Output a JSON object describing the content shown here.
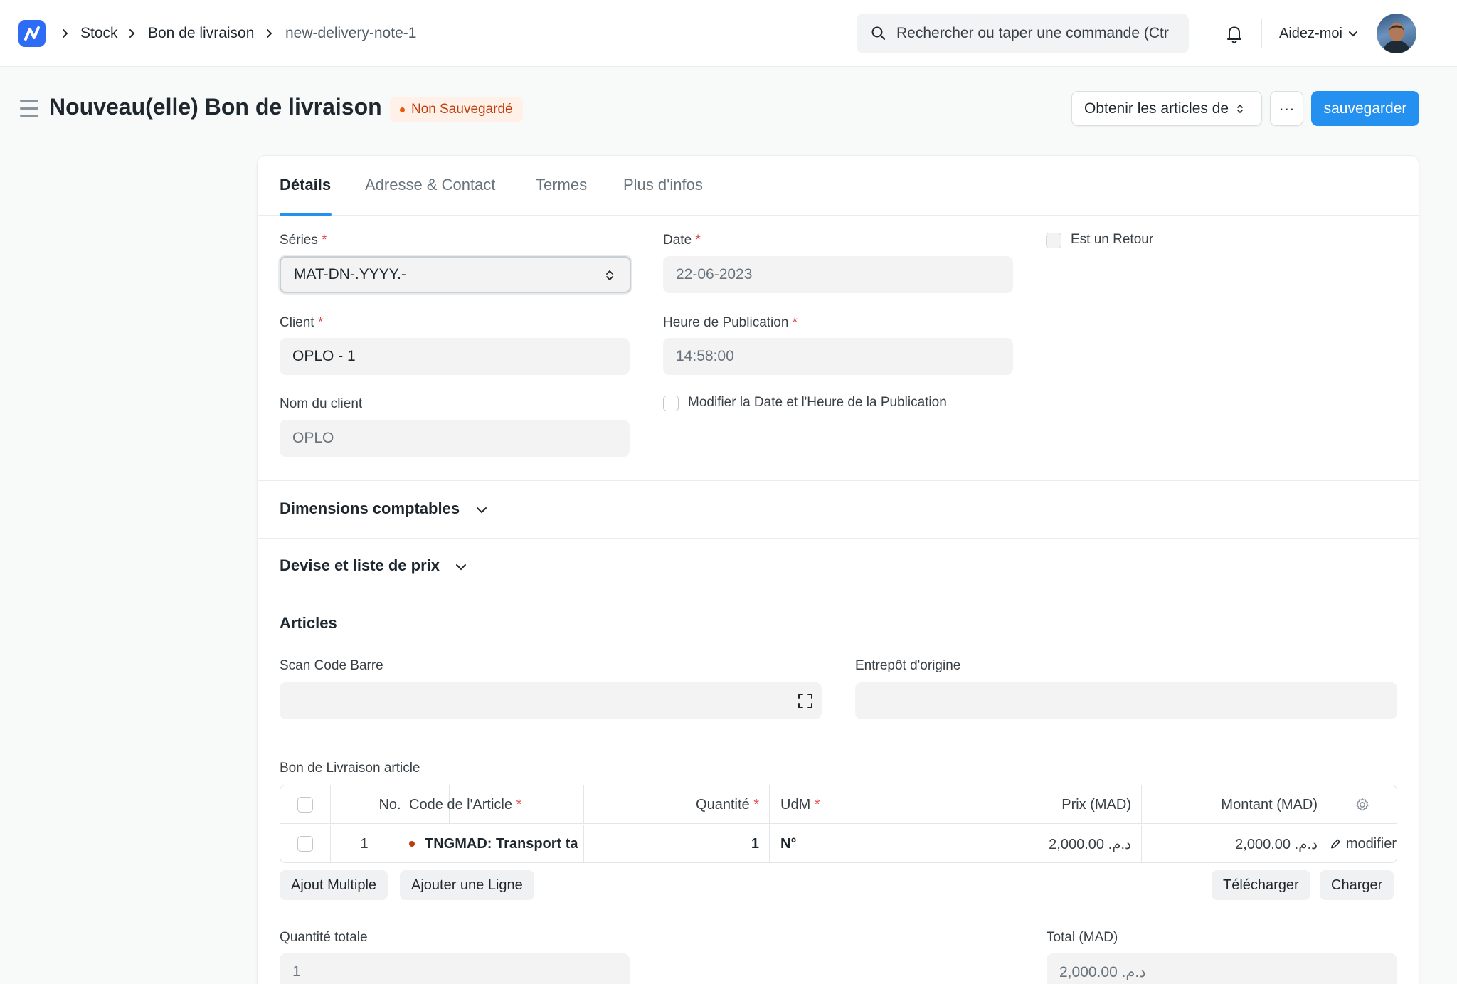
{
  "colors": {
    "primary": "#2490ef",
    "logo": "#2f6cf5",
    "unsaved_bg": "#fff1e7",
    "unsaved_text": "#bd3e0c"
  },
  "navbar": {
    "breadcrumbs": [
      "Stock",
      "Bon de livraison",
      "new-delivery-note-1"
    ],
    "search_placeholder": "Rechercher ou taper une commande (Ctr",
    "help_label": "Aidez-moi"
  },
  "header": {
    "title": "Nouveau(elle) Bon de livraison",
    "status": "Non Sauvegardé",
    "get_items_label": "Obtenir les articles de",
    "more_label": "···",
    "save_label": "sauvegarder"
  },
  "tabs": [
    "Détails",
    "Adresse & Contact",
    "Termes",
    "Plus d'infos"
  ],
  "details": {
    "series_label": "Séries",
    "series_value": "MAT-DN-.YYYY.-",
    "date_label": "Date",
    "date_value": "22-06-2023",
    "is_return_label": "Est un Retour",
    "client_label": "Client",
    "client_value": "OPLO - 1",
    "posting_time_label": "Heure de Publication",
    "posting_time_value": "14:58:00",
    "client_name_label": "Nom du client",
    "client_name_value": "OPLO",
    "edit_posting_label": "Modifier la Date et l'Heure de la Publication"
  },
  "sections": {
    "accounting_dimensions": "Dimensions comptables",
    "currency_price_list": "Devise et liste de prix",
    "articles": "Articles"
  },
  "articles": {
    "scan_barcode_label": "Scan Code Barre",
    "source_warehouse_label": "Entrepôt d'origine",
    "table_label": "Bon de Livraison article",
    "columns": [
      "No.",
      "Code de l'Article",
      "Quantité",
      "UdM",
      "Prix (MAD)",
      "Montant (MAD)"
    ],
    "rows": [
      {
        "no": "1",
        "item_code": "TNGMAD: Transport ta",
        "qty": "1",
        "uom": "N°",
        "rate": "د.م. 2,000.00",
        "amount": "د.م. 2,000.00",
        "edit": "modifier"
      }
    ],
    "add_multiple": "Ajout Multiple",
    "add_row": "Ajouter une Ligne",
    "download": "Télécharger",
    "upload": "Charger"
  },
  "totals": {
    "total_qty_label": "Quantité totale",
    "total_qty_value": "1",
    "total_label": "Total (MAD)",
    "total_value": "د.م. 2,000.00"
  }
}
